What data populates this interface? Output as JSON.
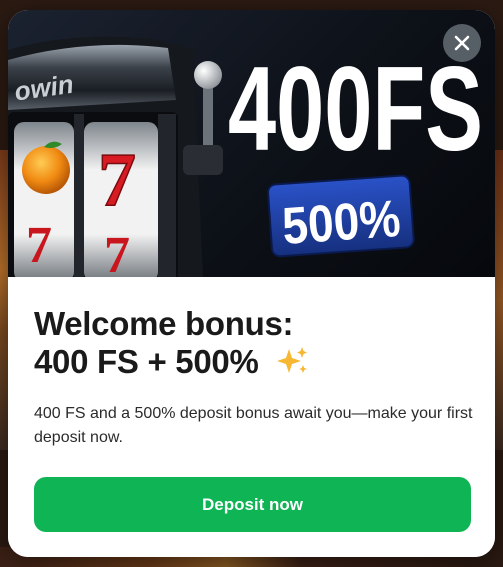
{
  "banner": {
    "brand_text": "owin",
    "headline": "400FS",
    "percent_badge": "500%",
    "close_icon": "close-icon"
  },
  "content": {
    "title_line1": "Welcome bonus:",
    "title_line2": "400 FS + 500%",
    "title_icon": "sparkles-icon",
    "description": "400 FS and a 500% deposit bonus await you—make your first deposit now.",
    "deposit_label": "Deposit now"
  },
  "colors": {
    "accent_green": "#0fb455",
    "badge_blue": "#1f3ea8",
    "banner_dark": "#0d1118"
  }
}
